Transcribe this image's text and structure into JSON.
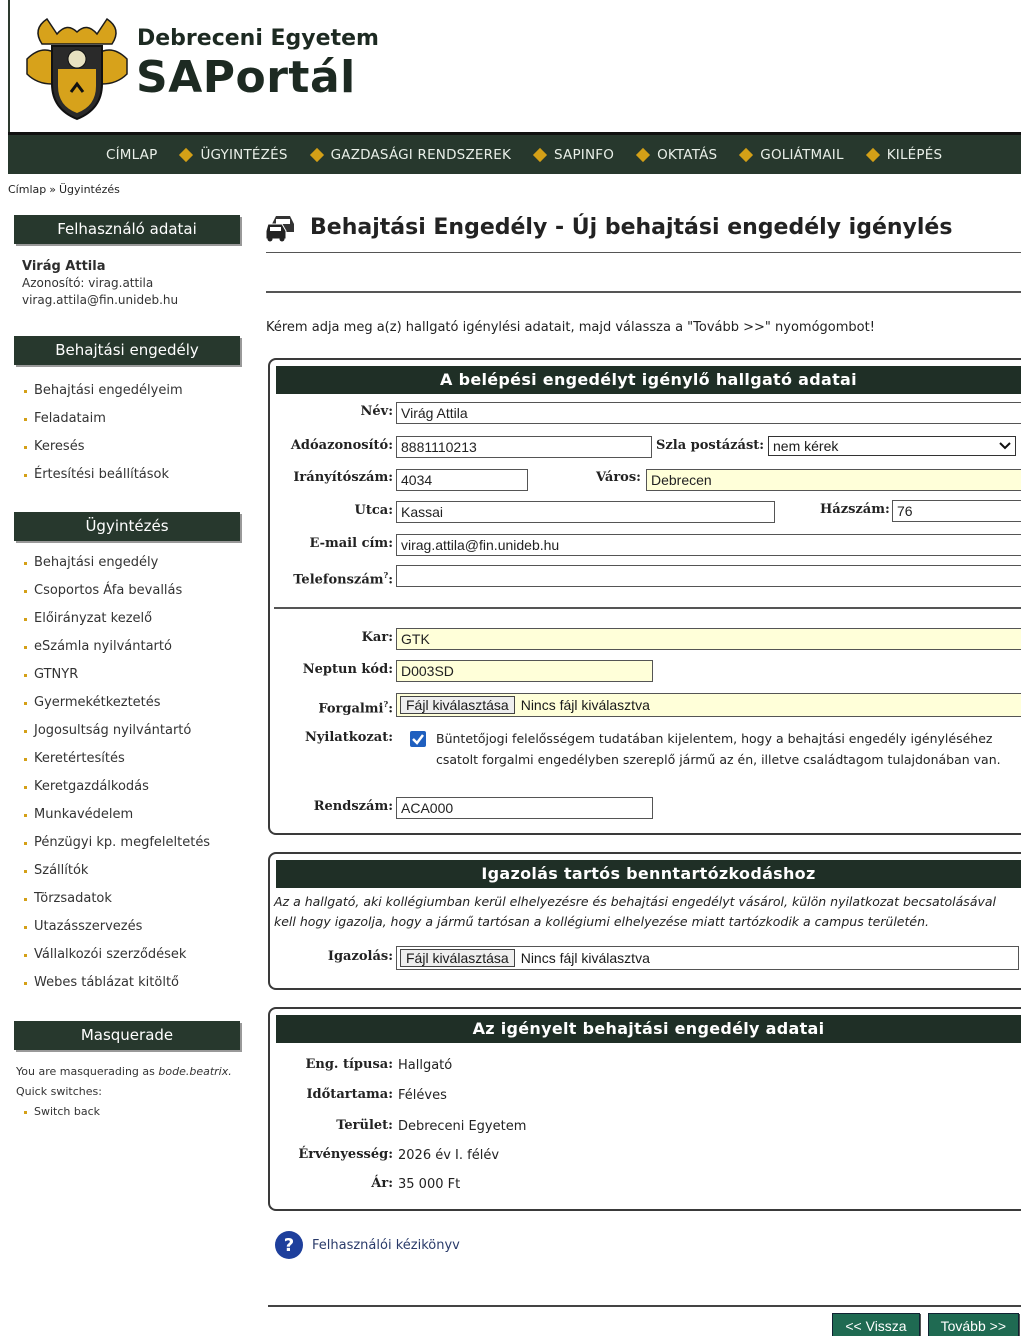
{
  "header": {
    "university": "Debreceni Egyetem",
    "portal": "SAPortál"
  },
  "nav": {
    "items": [
      "CÍMLAP",
      "ÜGYINTÉZÉS",
      "GAZDASÁGI RENDSZEREK",
      "SAPINFO",
      "OKTATÁS",
      "GOLIÁTMAIL",
      "KILÉPÉS"
    ],
    "accent": "#d4a017",
    "background": "#27382d"
  },
  "breadcrumb": [
    "Címlap",
    "Ügyintézés"
  ],
  "sidebar": {
    "user_box_title": "Felhasználó adatai",
    "user_name": "Virág Attila",
    "user_id_line": "Azonosító: virag.attila",
    "user_email": "virag.attila@fin.unideb.hu",
    "permit_box_title": "Behajtási engedély",
    "permit_items": [
      "Behajtási engedélyeim",
      "Feladataim",
      "Keresés",
      "Értesítési beállítások"
    ],
    "admin_box_title": "Ügyintézés",
    "admin_items": [
      "Behajtási engedély",
      "Csoportos Áfa bevallás",
      "Előirányzat kezelő",
      "eSzámla nyilvántartó",
      "GTNYR",
      "Gyermekétkeztetés",
      "Jogosultság nyilvántartó",
      "Keretértesítés",
      "Keretgazdálkodás",
      "Munkavédelem",
      "Pénzügyi kp. megfeleltetés",
      "Szállítók",
      "Törzsadatok",
      "Utazásszervezés",
      "Vállalkozói szerződések",
      "Webes táblázat kitöltő"
    ],
    "masq_box_title": "Masquerade",
    "masq_text_prefix": "You are masquerading as",
    "masq_user": "bode.beatrix.",
    "masq_quick": "Quick switches:",
    "masq_switch_back": "Switch back"
  },
  "main": {
    "title": "Behajtási Engedély - Új behajtási engedély igénylés",
    "instruction": "Kérem adja meg a(z) hallgató igénylési adatait, majd válassza a \"Tovább >>\" nyomógombot!",
    "section1": {
      "title": "A belépési engedélyt igénylő hallgató adatai",
      "name_label": "Név:",
      "name_value": "Virág Attila",
      "tax_label": "Adóazonosító:",
      "tax_value": "8881110213",
      "invoice_label": "Szla postázást:",
      "invoice_value": "nem kérek",
      "zip_label": "Irányítószám:",
      "zip_value": "4034",
      "city_label": "Város:",
      "city_value": "Debrecen",
      "street_label": "Utca:",
      "street_value": "Kassai",
      "house_label": "Házszám:",
      "house_value": "76",
      "email_label": "E-mail cím:",
      "email_value": "virag.attila@fin.unideb.hu",
      "phone_label": "Telefonszám",
      "phone_value": "",
      "faculty_label": "Kar:",
      "faculty_value": "GTK",
      "neptun_label": "Neptun kód:",
      "neptun_value": "D003SD",
      "forgalmi_label": "Forgalmi",
      "file_button": "Fájl kiválasztása",
      "file_none": "Nincs fájl kiválasztva",
      "declaration_label": "Nyilatkozat:",
      "declaration_text": "Büntetőjogi felelősségem tudatában kijelentem, hogy a behajtási engedély igényléséhez csatolt forgalmi engedélyben szereplő jármű az én, illetve családtagom tulajdonában van.",
      "plate_label": "Rendszám:",
      "plate_value": "ACA000"
    },
    "section2": {
      "title": "Igazolás tartós benntartózkodáshoz",
      "text": "Az a hallgató, aki kollégiumban kerül elhelyezésre és behajtási engedélyt vásárol, külön nyilatkozat becsatolásával kell hogy igazolja, hogy a jármű tartósan a kollégiumi elhelyezése miatt tartózkodik a campus területén.",
      "cert_label": "Igazolás:",
      "file_button": "Fájl kiválasztása",
      "file_none": "Nincs fájl kiválasztva"
    },
    "section3": {
      "title": "Az igényelt behajtási engedély adatai",
      "type_label": "Eng. típusa:",
      "type_value": "Hallgató",
      "duration_label": "Időtartama:",
      "duration_value": "Féléves",
      "area_label": "Terület:",
      "area_value": "Debreceni Egyetem",
      "validity_label": "Érvényesség:",
      "validity_value": "2026 év I. félév",
      "price_label": "Ár:",
      "price_value": "35 000 Ft"
    },
    "manual_link": "Felhasználói kézikönyv",
    "back_button": "<< Vissza",
    "next_button": "Tovább >>"
  }
}
